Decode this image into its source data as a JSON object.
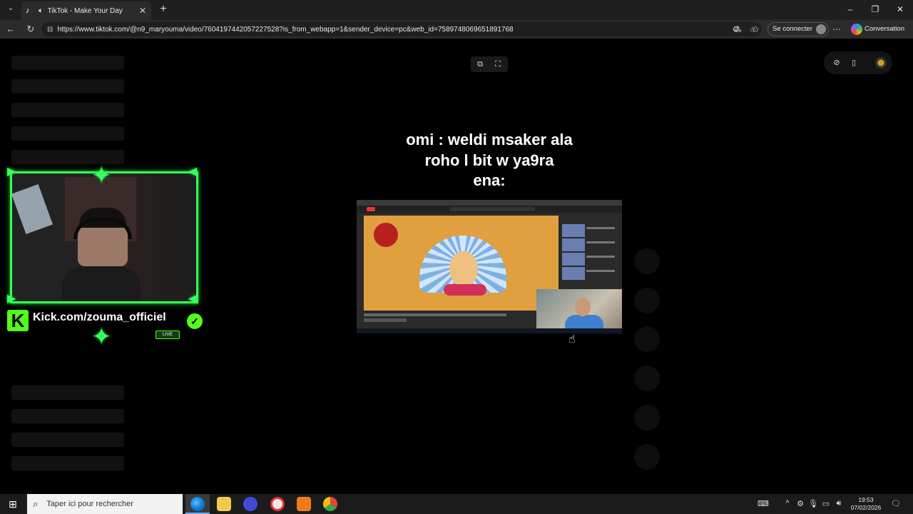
{
  "browser": {
    "tab_title": "TikTok - Make Your Day",
    "url": "https://www.tiktok.com/@n9_maryouma/video/7604197442057227528?is_from_webapp=1&sender_device=pc&web_id=7589748069651891768",
    "signin_label": "Se connecter",
    "conversation_label": "Conversation"
  },
  "video": {
    "caption_line1": "omi : weldi  msaker  ala",
    "caption_line2": "roho l bit w ya9ra",
    "caption_line3": "ena:"
  },
  "overlay": {
    "kick_url": "Kick.com/zouma_officiel",
    "live_badge": "LIVE"
  },
  "taskbar": {
    "search_placeholder": "Taper ici pour rechercher",
    "time": "19:53",
    "date": "07/02/2026"
  },
  "colors": {
    "accent_green": "#36ff5a",
    "kick_green": "#53fc18"
  }
}
